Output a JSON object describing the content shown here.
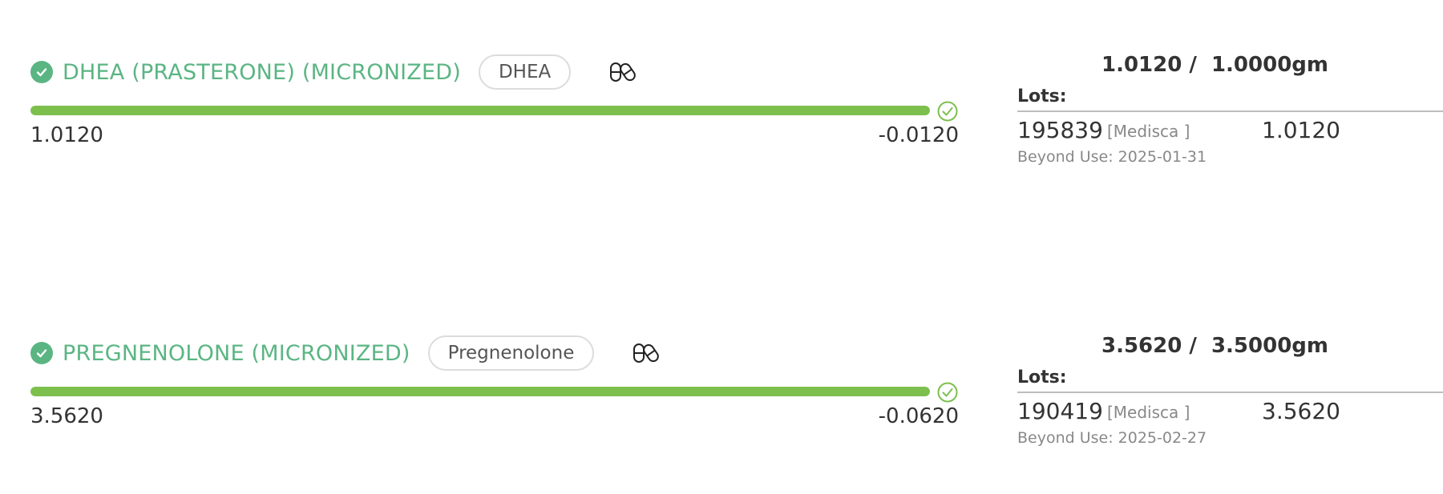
{
  "ingredients": [
    {
      "name": "DHEA (PRASTERONE) (MICRONIZED)",
      "tag": "DHEA",
      "progress": 1.0,
      "measured": "1.0120",
      "remaining": "-0.0120",
      "ratio": "1.0120 /  1.0000gm",
      "lots_label": "Lots:",
      "lot": {
        "number": "195839",
        "vendor": "[Medisca ]",
        "quantity": "1.0120",
        "beyond_use": "Beyond Use: 2025-01-31"
      }
    },
    {
      "name": "PREGNENOLONE (MICRONIZED)",
      "tag": "Pregnenolone",
      "progress": 1.0,
      "measured": "3.5620",
      "remaining": "-0.0620",
      "ratio": "3.5620 /  3.5000gm",
      "lots_label": "Lots:",
      "lot": {
        "number": "190419",
        "vendor": "[Medisca ]",
        "quantity": "3.5620",
        "beyond_use": "Beyond Use: 2025-02-27"
      }
    }
  ],
  "icons": {
    "status": "check-circle-icon",
    "capsules": "capsules-icon",
    "bar_complete": "check-outline-icon"
  },
  "colors": {
    "accent_green": "#5bb583",
    "bar_green": "#7dbf4d"
  }
}
